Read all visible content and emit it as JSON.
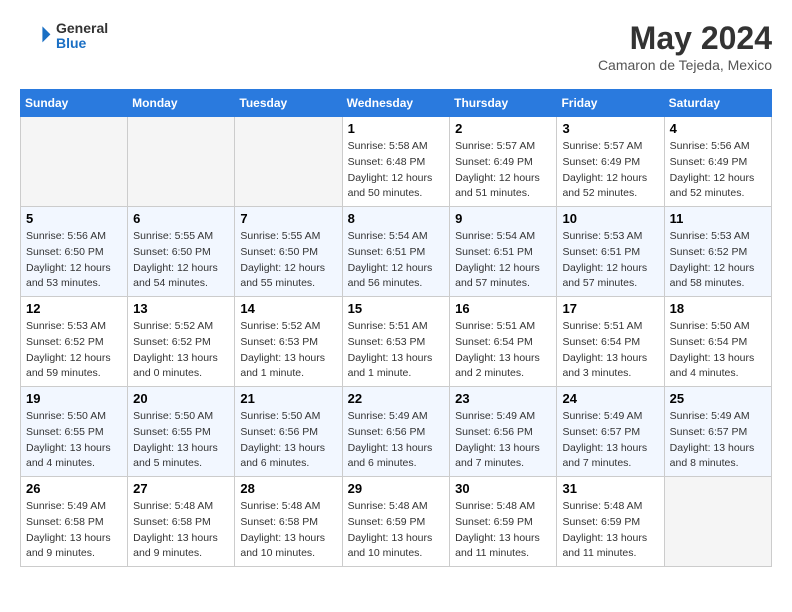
{
  "header": {
    "logo_general": "General",
    "logo_blue": "Blue",
    "month_title": "May 2024",
    "location": "Camaron de Tejeda, Mexico"
  },
  "days_of_week": [
    "Sunday",
    "Monday",
    "Tuesday",
    "Wednesday",
    "Thursday",
    "Friday",
    "Saturday"
  ],
  "weeks": [
    [
      {
        "day": "",
        "empty": true
      },
      {
        "day": "",
        "empty": true
      },
      {
        "day": "",
        "empty": true
      },
      {
        "day": "1",
        "sunrise": "5:58 AM",
        "sunset": "6:48 PM",
        "daylight": "12 hours and 50 minutes."
      },
      {
        "day": "2",
        "sunrise": "5:57 AM",
        "sunset": "6:49 PM",
        "daylight": "12 hours and 51 minutes."
      },
      {
        "day": "3",
        "sunrise": "5:57 AM",
        "sunset": "6:49 PM",
        "daylight": "12 hours and 52 minutes."
      },
      {
        "day": "4",
        "sunrise": "5:56 AM",
        "sunset": "6:49 PM",
        "daylight": "12 hours and 52 minutes."
      }
    ],
    [
      {
        "day": "5",
        "sunrise": "5:56 AM",
        "sunset": "6:50 PM",
        "daylight": "12 hours and 53 minutes."
      },
      {
        "day": "6",
        "sunrise": "5:55 AM",
        "sunset": "6:50 PM",
        "daylight": "12 hours and 54 minutes."
      },
      {
        "day": "7",
        "sunrise": "5:55 AM",
        "sunset": "6:50 PM",
        "daylight": "12 hours and 55 minutes."
      },
      {
        "day": "8",
        "sunrise": "5:54 AM",
        "sunset": "6:51 PM",
        "daylight": "12 hours and 56 minutes."
      },
      {
        "day": "9",
        "sunrise": "5:54 AM",
        "sunset": "6:51 PM",
        "daylight": "12 hours and 57 minutes."
      },
      {
        "day": "10",
        "sunrise": "5:53 AM",
        "sunset": "6:51 PM",
        "daylight": "12 hours and 57 minutes."
      },
      {
        "day": "11",
        "sunrise": "5:53 AM",
        "sunset": "6:52 PM",
        "daylight": "12 hours and 58 minutes."
      }
    ],
    [
      {
        "day": "12",
        "sunrise": "5:53 AM",
        "sunset": "6:52 PM",
        "daylight": "12 hours and 59 minutes."
      },
      {
        "day": "13",
        "sunrise": "5:52 AM",
        "sunset": "6:52 PM",
        "daylight": "13 hours and 0 minutes."
      },
      {
        "day": "14",
        "sunrise": "5:52 AM",
        "sunset": "6:53 PM",
        "daylight": "13 hours and 1 minute."
      },
      {
        "day": "15",
        "sunrise": "5:51 AM",
        "sunset": "6:53 PM",
        "daylight": "13 hours and 1 minute."
      },
      {
        "day": "16",
        "sunrise": "5:51 AM",
        "sunset": "6:54 PM",
        "daylight": "13 hours and 2 minutes."
      },
      {
        "day": "17",
        "sunrise": "5:51 AM",
        "sunset": "6:54 PM",
        "daylight": "13 hours and 3 minutes."
      },
      {
        "day": "18",
        "sunrise": "5:50 AM",
        "sunset": "6:54 PM",
        "daylight": "13 hours and 4 minutes."
      }
    ],
    [
      {
        "day": "19",
        "sunrise": "5:50 AM",
        "sunset": "6:55 PM",
        "daylight": "13 hours and 4 minutes."
      },
      {
        "day": "20",
        "sunrise": "5:50 AM",
        "sunset": "6:55 PM",
        "daylight": "13 hours and 5 minutes."
      },
      {
        "day": "21",
        "sunrise": "5:50 AM",
        "sunset": "6:56 PM",
        "daylight": "13 hours and 6 minutes."
      },
      {
        "day": "22",
        "sunrise": "5:49 AM",
        "sunset": "6:56 PM",
        "daylight": "13 hours and 6 minutes."
      },
      {
        "day": "23",
        "sunrise": "5:49 AM",
        "sunset": "6:56 PM",
        "daylight": "13 hours and 7 minutes."
      },
      {
        "day": "24",
        "sunrise": "5:49 AM",
        "sunset": "6:57 PM",
        "daylight": "13 hours and 7 minutes."
      },
      {
        "day": "25",
        "sunrise": "5:49 AM",
        "sunset": "6:57 PM",
        "daylight": "13 hours and 8 minutes."
      }
    ],
    [
      {
        "day": "26",
        "sunrise": "5:49 AM",
        "sunset": "6:58 PM",
        "daylight": "13 hours and 9 minutes."
      },
      {
        "day": "27",
        "sunrise": "5:48 AM",
        "sunset": "6:58 PM",
        "daylight": "13 hours and 9 minutes."
      },
      {
        "day": "28",
        "sunrise": "5:48 AM",
        "sunset": "6:58 PM",
        "daylight": "13 hours and 10 minutes."
      },
      {
        "day": "29",
        "sunrise": "5:48 AM",
        "sunset": "6:59 PM",
        "daylight": "13 hours and 10 minutes."
      },
      {
        "day": "30",
        "sunrise": "5:48 AM",
        "sunset": "6:59 PM",
        "daylight": "13 hours and 11 minutes."
      },
      {
        "day": "31",
        "sunrise": "5:48 AM",
        "sunset": "6:59 PM",
        "daylight": "13 hours and 11 minutes."
      },
      {
        "day": "",
        "empty": true
      }
    ]
  ]
}
